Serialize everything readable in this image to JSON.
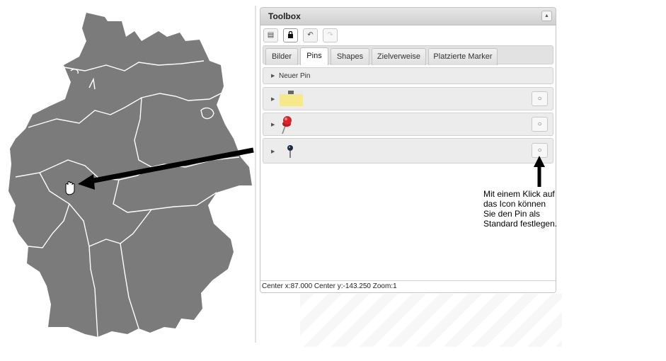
{
  "toolbox": {
    "title": "Toolbox",
    "collapse_glyph": "▲",
    "tools": [
      {
        "name": "save-icon",
        "glyph": "▤"
      },
      {
        "name": "lock-icon",
        "glyph": "🔒"
      },
      {
        "name": "undo-icon",
        "glyph": "↶"
      },
      {
        "name": "redo-icon",
        "glyph": "↷"
      }
    ],
    "tabs": [
      {
        "label": "Bilder",
        "active": false
      },
      {
        "label": "Pins",
        "active": true
      },
      {
        "label": "Shapes",
        "active": false
      },
      {
        "label": "Zielverweise",
        "active": false
      },
      {
        "label": "Platzierte Marker",
        "active": false
      }
    ],
    "new_pin_label": "Neuer Pin",
    "pins": [
      {
        "icon": "sticky-note-icon"
      },
      {
        "icon": "red-pushpin-icon"
      },
      {
        "icon": "dark-pin-icon"
      }
    ],
    "status": "Center x:87.000 Center y:-143.250 Zoom:1"
  },
  "annotation": {
    "lines": [
      "Mit einem Klick auf",
      "das Icon können",
      "Sie den Pin als",
      "Standard festlegen."
    ]
  },
  "colors": {
    "map_fill": "#7b7b7b",
    "map_border": "#ffffff",
    "arrow": "#000000",
    "note_yellow": "#f5e98a",
    "pin_red": "#d8242a"
  }
}
